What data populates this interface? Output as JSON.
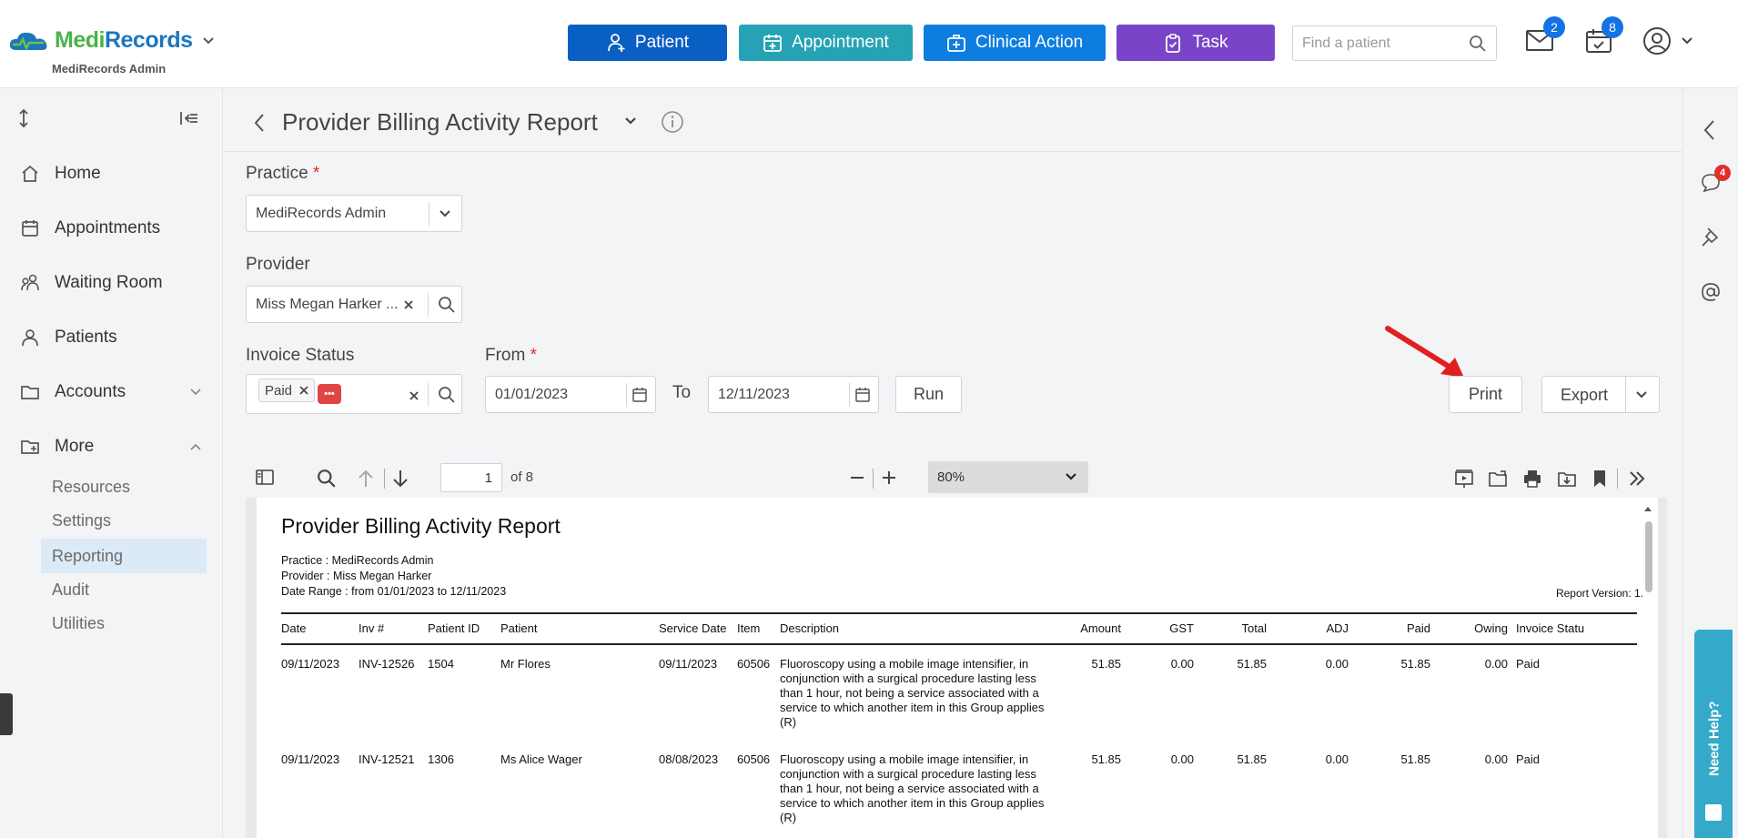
{
  "brand": {
    "name_part1": "Medi",
    "name_part2": "Records",
    "subtitle": "MediRecords Admin"
  },
  "header": {
    "buttons": [
      {
        "label": "Patient",
        "icon": "person-add-icon"
      },
      {
        "label": "Appointment",
        "icon": "calendar-add-icon"
      },
      {
        "label": "Clinical Action",
        "icon": "medical-case-icon"
      },
      {
        "label": "Task",
        "icon": "clipboard-check-icon"
      }
    ],
    "search_placeholder": "Find a patient",
    "mail_count": "2",
    "calendar_count": "8"
  },
  "sidebar": {
    "items": [
      {
        "label": "Home",
        "icon": "home-icon"
      },
      {
        "label": "Appointments",
        "icon": "calendar-icon"
      },
      {
        "label": "Waiting Room",
        "icon": "people-icon"
      },
      {
        "label": "Patients",
        "icon": "person-icon"
      },
      {
        "label": "Accounts",
        "icon": "folder-icon"
      },
      {
        "label": "More",
        "icon": "folder-plus-icon"
      }
    ],
    "sub_items": [
      "Resources",
      "Settings",
      "Reporting",
      "Audit",
      "Utilities"
    ],
    "active_sub_item": "Reporting"
  },
  "page": {
    "title": "Provider Billing Activity Report",
    "practice_label": "Practice",
    "practice_value": "MediRecords Admin",
    "provider_label": "Provider",
    "provider_value": "Miss Megan Harker ...",
    "invoice_status_label": "Invoice Status",
    "invoice_status_chip": "Paid",
    "more_chip": "•••",
    "from_label": "From",
    "from_value": "01/01/2023",
    "to_label": "To",
    "to_value": "12/11/2023",
    "run_label": "Run",
    "print_label": "Print",
    "export_label": "Export",
    "required_mark": "*"
  },
  "viewer": {
    "page_number": "1",
    "page_of": "of 8",
    "zoom": "80%"
  },
  "report": {
    "title": "Provider Billing Activity Report",
    "practice_line": "Practice : MediRecords Admin",
    "provider_line": "Provider : Miss Megan Harker",
    "date_range_line": "Date Range : from 01/01/2023 to 12/11/2023",
    "version": "Report Version: 1.",
    "columns": [
      "Date",
      "Inv #",
      "Patient ID",
      "Patient",
      "Service Date",
      "Item",
      "Description",
      "Amount",
      "GST",
      "Total",
      "ADJ",
      "Paid",
      "Owing",
      "Invoice Statu"
    ],
    "rows": [
      {
        "date": "09/11/2023",
        "inv": "INV-12526",
        "patient_id": "1504",
        "patient": "Mr Flores",
        "service_date": "09/11/2023",
        "item": "60506",
        "description": "Fluoroscopy using a mobile image intensifier, in conjunction with a surgical procedure lasting less than 1 hour, not being a service associated with a service to which another item in this Group applies (R)",
        "amount": "51.85",
        "gst": "0.00",
        "total": "51.85",
        "adj": "0.00",
        "paid": "51.85",
        "owing": "0.00",
        "status": "Paid"
      },
      {
        "date": "09/11/2023",
        "inv": "INV-12521",
        "patient_id": "1306",
        "patient": "Ms Alice Wager",
        "service_date": "08/08/2023",
        "item": "60506",
        "description": "Fluoroscopy using a mobile image intensifier, in conjunction with a surgical procedure lasting less than 1 hour, not being a service associated with a service to which another item in this Group applies (R)",
        "amount": "51.85",
        "gst": "0.00",
        "total": "51.85",
        "adj": "0.00",
        "paid": "51.85",
        "owing": "0.00",
        "status": "Paid"
      }
    ]
  },
  "rail": {
    "chat_badge": "4",
    "help_label": "Need Help?"
  },
  "colors": {
    "primary": "#0a5fc2",
    "teal": "#25a3b4",
    "blue": "#0e7de0",
    "purple": "#7a44c8",
    "accent_red": "#e02b2b"
  }
}
